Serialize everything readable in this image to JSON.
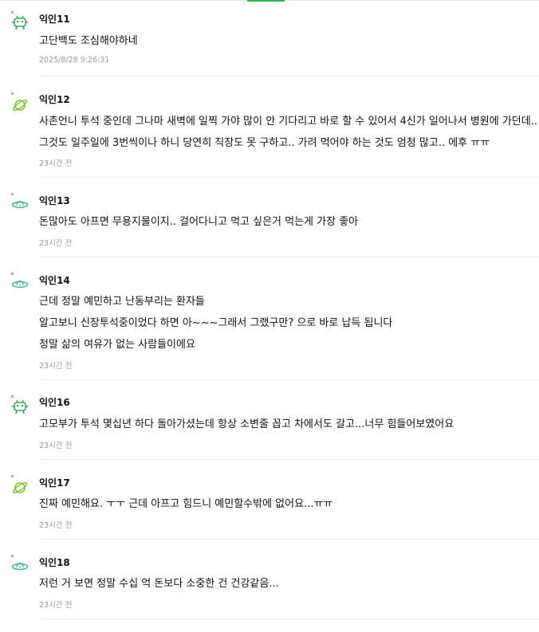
{
  "colors": {
    "accent": "#34b55a",
    "text": "#111111",
    "meta": "#999999",
    "divider": "#ebebeb"
  },
  "comments": [
    {
      "author": "익인11",
      "icon": "alien-icon",
      "lines": [
        "고단백도 조심해야하네"
      ],
      "time": "2025/8/28 9:26:31"
    },
    {
      "author": "익인12",
      "icon": "planet-icon",
      "lines": [
        "사촌언니 투석 중인데 그나마 새벽에 일찍 가야 많이 안 기다리고 바로 할 수 있어서 4신가 일어나서 병원에 가던데..",
        "그것도 일주일에 3번씩이나 하니 당연히 직장도 못 구하고.. 가려 먹어야 하는 것도 엄청 많고.. 에후 ㅠㅠ"
      ],
      "time": "23시간 전"
    },
    {
      "author": "익인13",
      "icon": "ufo-icon",
      "lines": [
        "돈많아도 아프면 무용지물이지.. 걸어다니고 먹고 싶은거 먹는게 가장 좋아"
      ],
      "time": "23시간 전"
    },
    {
      "author": "익인14",
      "icon": "ufo-icon",
      "lines": [
        "근데 정말 예민하고 난동부리는 환자들",
        "알고보니 신장투석중이었다 하면 아~~~그래서 그랬구만? 으로 바로 납득 됩니다",
        "정말 삶의 여유가 없는 사람들이에요"
      ],
      "time": "23시간 전"
    },
    {
      "author": "익인16",
      "icon": "alien-icon",
      "lines": [
        "고모부가 투석 몇십년 하다 돌아가셨는데 항상 소변줄 꼽고 차에서도 갈고...너무 힘들어보였어요"
      ],
      "time": "23시간 전"
    },
    {
      "author": "익인17",
      "icon": "planet-icon",
      "lines": [
        "진짜 예민해요. ㅜㅜ 근데 아프고 힘드니 예민할수밖에 없어요...ㅠㅠ"
      ],
      "time": "23시간 전"
    },
    {
      "author": "익인18",
      "icon": "ufo-icon",
      "lines": [
        "저런 거 보면 정말 수십 억 돈보다 소중한 건 건강같음..."
      ],
      "time": "23시간 전"
    }
  ]
}
